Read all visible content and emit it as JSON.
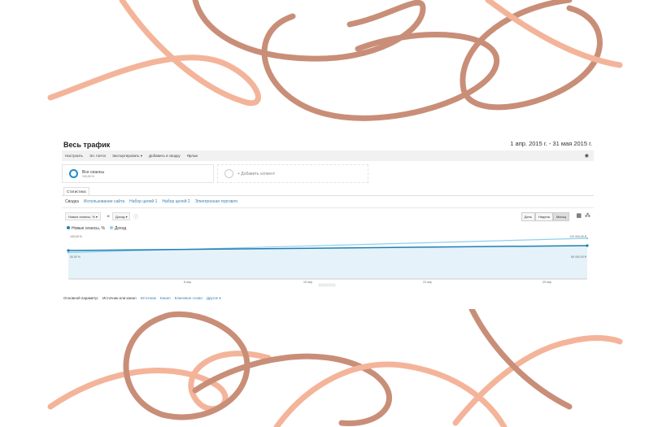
{
  "header": {
    "title": "Весь трафик",
    "date_range": "1 апр. 2015 г. - 31 мая 2015 г."
  },
  "toolbar": {
    "items": [
      "Настроить",
      "Эл. почта",
      "Экспортировать ▾",
      "Добавить в сводку",
      "Ярлык"
    ]
  },
  "segments": {
    "all": "Все сеансы",
    "all_pct": "100,00 %",
    "add": "+ Добавить сегмент"
  },
  "tab": "Статистика",
  "subnav": [
    "Сводка",
    "Использование сайта",
    "Набор целей 1",
    "Набор целей 2",
    "Электронная торговля"
  ],
  "metric_selectors": {
    "metric1": "Новые сеансы, % ▾",
    "vs": "и",
    "metric2": "Доход ▾"
  },
  "granularity": {
    "day": "День",
    "week": "Неделя",
    "month": "Месяц",
    "selected": "month"
  },
  "colors": {
    "series1": "#1f7fb5",
    "series2": "#8fd0ea",
    "area": "#e6f2f9"
  },
  "chart_data": {
    "type": "line",
    "series": [
      {
        "name": "Новые сеансы, %",
        "axis": "left",
        "values": [
          70,
          82
        ]
      },
      {
        "name": "Доход",
        "axis": "right",
        "values": [
          78000,
          120000
        ]
      }
    ],
    "x_ticks": [
      "8 апр.",
      "15 апр.",
      "22 апр.",
      "29 апр."
    ],
    "left_ticks": [
      "100,00 %",
      "50,00 %"
    ],
    "right_ticks": [
      "120 000,00 ₽",
      "60 000,00 ₽"
    ],
    "ylim_left": [
      0,
      100
    ],
    "ylim_right": [
      0,
      120000
    ]
  },
  "dimensions": {
    "label": "Основной параметр:",
    "items": [
      "Источник или канал",
      "Источник",
      "Канал",
      "Ключевое слово",
      "Другое ▾"
    ]
  }
}
